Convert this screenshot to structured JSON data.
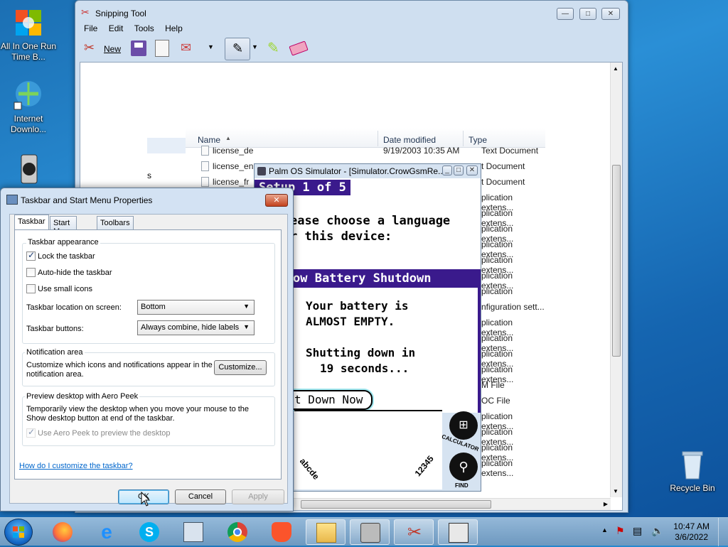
{
  "desktop": {
    "icons": [
      {
        "label": "All In One Run Time B...",
        "icon": "all-in-one-runtime-icon"
      },
      {
        "label": "Internet Downlo...",
        "icon": "internet-download-manager-icon"
      },
      {
        "label": "Recycle Bin",
        "icon": "recycle-bin-icon"
      }
    ]
  },
  "snipping_tool": {
    "title": "Snipping Tool",
    "menu": [
      "File",
      "Edit",
      "Tools",
      "Help"
    ],
    "toolbar": {
      "new_label": "New"
    },
    "explorer": {
      "columns": [
        "Name",
        "Date modified",
        "Type"
      ],
      "left_fragment": "s",
      "rows": [
        {
          "name": "license_de",
          "date": "9/19/2003 10:35 AM",
          "type": "Text Document"
        },
        {
          "name": "license_en",
          "date": "",
          "type": "t Document"
        },
        {
          "name": "license_fr",
          "date": "",
          "type": "t Document"
        },
        {
          "name": "",
          "date": "",
          "type": "plication extens..."
        },
        {
          "name": "",
          "date": "",
          "type": "plication extens..."
        },
        {
          "name": "",
          "date": "",
          "type": "plication extens..."
        },
        {
          "name": "",
          "date": "",
          "type": "plication extens..."
        },
        {
          "name": "",
          "date": "",
          "type": "plication extens..."
        },
        {
          "name": "",
          "date": "",
          "type": "plication extens..."
        },
        {
          "name": "",
          "date": "",
          "type": "plication"
        },
        {
          "name": "",
          "date": "",
          "type": "nfiguration sett..."
        },
        {
          "name": "",
          "date": "",
          "type": "plication extens..."
        },
        {
          "name": "",
          "date": "",
          "type": "plication extens..."
        },
        {
          "name": "",
          "date": "",
          "type": "plication extens..."
        },
        {
          "name": "",
          "date": "",
          "type": "plication extens..."
        },
        {
          "name": "",
          "date": "",
          "type": "M File"
        },
        {
          "name": "",
          "date": "",
          "type": "OC File"
        },
        {
          "name": "",
          "date": "",
          "type": "plication extens..."
        },
        {
          "name": "",
          "date": "",
          "type": "plication extens..."
        },
        {
          "name": "",
          "date": "",
          "type": "plication extens..."
        },
        {
          "name": "",
          "date": "",
          "type": "plication extens..."
        }
      ]
    }
  },
  "palm": {
    "title": "Palm OS Simulator - [Simulator.CrowGsmRe...",
    "setup_header": "Setup 1 of 5",
    "prompt_line1": "ease choose a language",
    "prompt_line2": "r this device:",
    "alert_title": "ow Battery Shutdown",
    "alert_line1": "Your battery is",
    "alert_line2": "ALMOST EMPTY.",
    "alert_line3": "Shutting down in",
    "alert_line4": "19  seconds...",
    "alert_button": "t Down Now",
    "graffiti_left": "abcde",
    "graffiti_right": "12345",
    "calc_label": "CALCULATOR",
    "find_label": "FIND",
    "accent": "#3a1a8c"
  },
  "dialog": {
    "title": "Taskbar and Start Menu Properties",
    "tabs": [
      "Taskbar",
      "Start Menu",
      "Toolbars"
    ],
    "appearance_label": "Taskbar appearance",
    "lock_label": "Lock the taskbar",
    "lock_checked": true,
    "autohide_label": "Auto-hide the taskbar",
    "small_icons_label": "Use small icons",
    "location_label": "Taskbar location on screen:",
    "location_value": "Bottom",
    "buttons_label": "Taskbar buttons:",
    "buttons_value": "Always combine, hide labels",
    "notif_label": "Notification area",
    "notif_text": "Customize which icons and notifications appear in the notification area.",
    "customize_button": "Customize...",
    "peek_label": "Preview desktop with Aero Peek",
    "peek_text": "Temporarily view the desktop when you move your mouse to the Show desktop button at end of the taskbar.",
    "peek_checkbox": "Use Aero Peek to preview the desktop",
    "help_link": "How do I customize the taskbar?",
    "ok": "OK",
    "cancel": "Cancel",
    "apply": "Apply"
  },
  "taskbar": {
    "time": "10:47 AM",
    "date": "3/6/2022",
    "apps": [
      "firefox-icon",
      "internet-explorer-icon",
      "skype-icon",
      "network-computer-icon",
      "chrome-icon",
      "brave-icon",
      "file-explorer-icon",
      "palm-simulator-icon",
      "snipping-tool-icon",
      "app-window-icon"
    ]
  }
}
